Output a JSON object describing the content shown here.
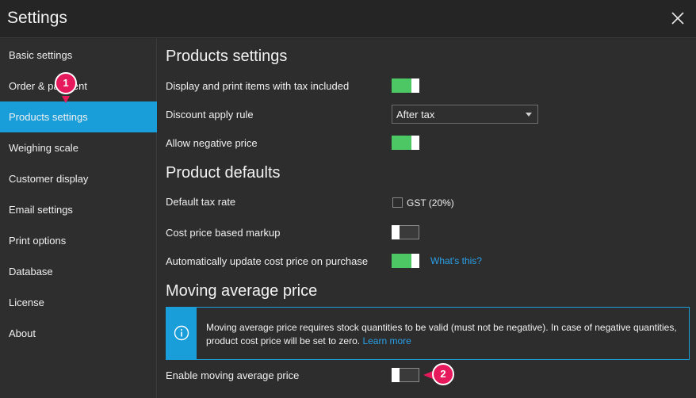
{
  "window": {
    "title": "Settings",
    "close_icon": "close-icon"
  },
  "sidebar": {
    "items": [
      {
        "label": "Basic settings"
      },
      {
        "label": "Order & payment"
      },
      {
        "label": "Products settings"
      },
      {
        "label": "Weighing scale"
      },
      {
        "label": "Customer display"
      },
      {
        "label": "Email settings"
      },
      {
        "label": "Print options"
      },
      {
        "label": "Database"
      },
      {
        "label": "License"
      },
      {
        "label": "About"
      }
    ],
    "active_item": "Products settings"
  },
  "products_settings": {
    "title": "Products settings",
    "display_tax_included_label": "Display and print items with tax included",
    "display_tax_included_value": true,
    "discount_rule_label": "Discount apply rule",
    "discount_rule_value": "After tax",
    "allow_negative_label": "Allow negative price",
    "allow_negative_value": true
  },
  "product_defaults": {
    "title": "Product defaults",
    "default_tax_label": "Default tax rate",
    "default_tax_option": "GST (20%)",
    "default_tax_checked": false,
    "cost_markup_label": "Cost price based markup",
    "cost_markup_value": false,
    "auto_update_label": "Automatically update cost price on purchase",
    "auto_update_value": true,
    "whats_this_link": "What's this?"
  },
  "moving_average": {
    "title": "Moving average price",
    "info_text": "Moving average price requires stock quantities to be valid (must not be negative). In case of negative quantities, product cost price will be set to zero.",
    "learn_more_link": "Learn more",
    "info_icon": "info-icon",
    "enable_label": "Enable moving average price",
    "enable_value": false
  },
  "callouts": {
    "one": "1",
    "two": "2"
  },
  "colors": {
    "accent": "#1a9ed9",
    "toggle_on": "#4cc764",
    "callout": "#e6195c"
  }
}
